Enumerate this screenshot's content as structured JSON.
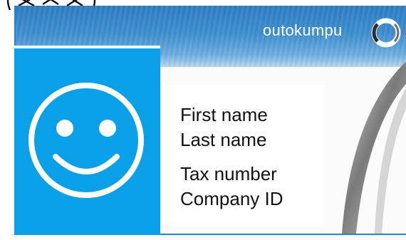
{
  "brand": {
    "name": "outokumpu",
    "logo_icon": "outokumpu-ring-icon",
    "colors": {
      "header_blue": "#2f7fc4",
      "photo_blue": "#0aa0e8",
      "border_blue": "#1f86d6"
    }
  },
  "photo": {
    "placeholder_icon": "smiley-face-icon"
  },
  "holder": {
    "first_name": "First name",
    "last_name": "Last name",
    "tax_number": "Tax number",
    "company_id": "Company ID"
  }
}
